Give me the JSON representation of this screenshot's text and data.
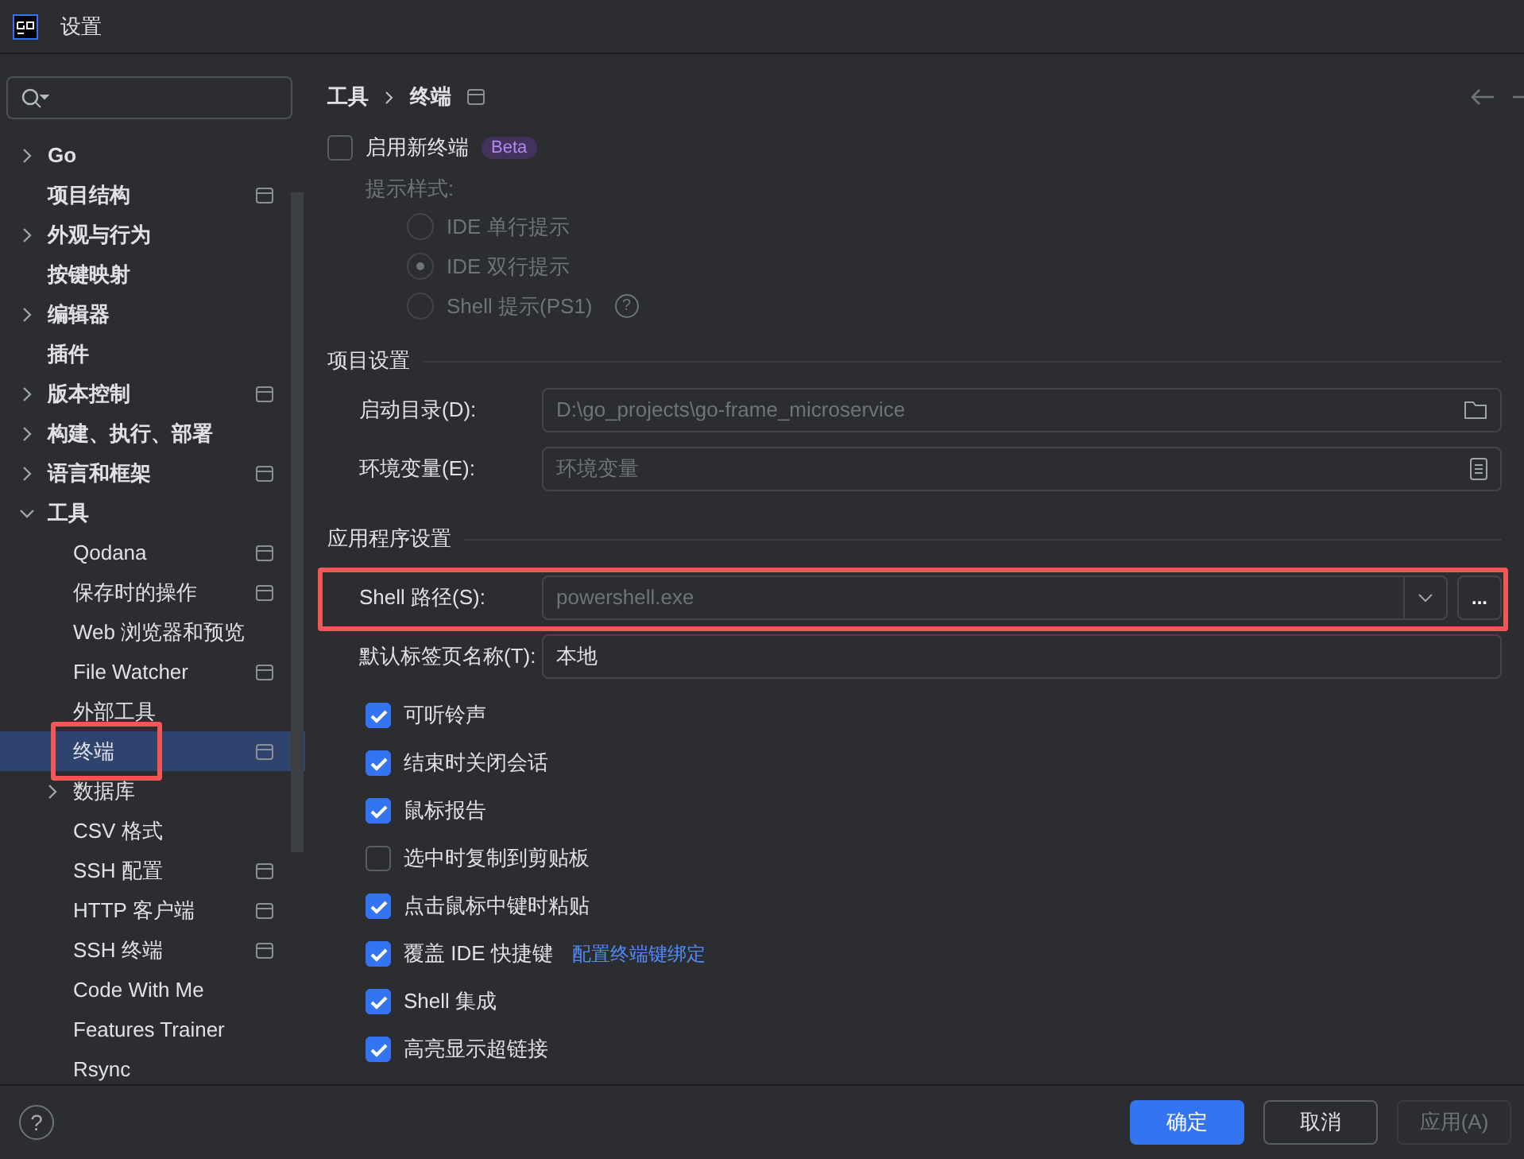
{
  "window": {
    "title": "设置"
  },
  "sidebar": {
    "items": [
      {
        "label": "Go",
        "kind": "group",
        "expanded": false,
        "project_scope": false,
        "selected": false
      },
      {
        "label": "项目结构",
        "kind": "leaf",
        "project_scope": true,
        "selected": false
      },
      {
        "label": "外观与行为",
        "kind": "group",
        "expanded": false,
        "project_scope": false,
        "selected": false
      },
      {
        "label": "按键映射",
        "kind": "leaf",
        "project_scope": false,
        "selected": false
      },
      {
        "label": "编辑器",
        "kind": "group",
        "expanded": false,
        "project_scope": false,
        "selected": false
      },
      {
        "label": "插件",
        "kind": "leaf",
        "project_scope": false,
        "selected": false
      },
      {
        "label": "版本控制",
        "kind": "group",
        "expanded": false,
        "project_scope": true,
        "selected": false
      },
      {
        "label": "构建、执行、部署",
        "kind": "group",
        "expanded": false,
        "project_scope": false,
        "selected": false
      },
      {
        "label": "语言和框架",
        "kind": "group",
        "expanded": false,
        "project_scope": true,
        "selected": false
      },
      {
        "label": "工具",
        "kind": "group",
        "expanded": true,
        "project_scope": false,
        "selected": false,
        "children": [
          {
            "label": "Qodana",
            "kind": "leaf",
            "project_scope": true,
            "selected": false
          },
          {
            "label": "保存时的操作",
            "kind": "leaf",
            "project_scope": true,
            "selected": false
          },
          {
            "label": "Web 浏览器和预览",
            "kind": "leaf",
            "project_scope": false,
            "selected": false
          },
          {
            "label": "File Watcher",
            "kind": "leaf",
            "project_scope": true,
            "selected": false
          },
          {
            "label": "外部工具",
            "kind": "leaf",
            "project_scope": false,
            "selected": false
          },
          {
            "label": "终端",
            "kind": "leaf",
            "project_scope": true,
            "selected": true,
            "highlighted": true
          },
          {
            "label": "数据库",
            "kind": "group",
            "expanded": false,
            "project_scope": false,
            "selected": false
          },
          {
            "label": "CSV 格式",
            "kind": "leaf",
            "project_scope": false,
            "selected": false
          },
          {
            "label": "SSH 配置",
            "kind": "leaf",
            "project_scope": true,
            "selected": false
          },
          {
            "label": "HTTP 客户端",
            "kind": "leaf",
            "project_scope": true,
            "selected": false
          },
          {
            "label": "SSH 终端",
            "kind": "leaf",
            "project_scope": true,
            "selected": false
          },
          {
            "label": "Code With Me",
            "kind": "leaf",
            "project_scope": false,
            "selected": false
          },
          {
            "label": "Features Trainer",
            "kind": "leaf",
            "project_scope": false,
            "selected": false
          },
          {
            "label": "Rsync",
            "kind": "leaf",
            "project_scope": false,
            "selected": false
          }
        ]
      }
    ]
  },
  "breadcrumb": [
    "工具",
    "终端"
  ],
  "new_terminal": {
    "label": "启用新终端",
    "checked": false,
    "badge": "Beta",
    "prompt_label": "提示样式:",
    "disabled": true,
    "options": [
      {
        "label": "IDE 单行提示",
        "selected": false
      },
      {
        "label": "IDE 双行提示",
        "selected": true
      },
      {
        "label": "Shell 提示(PS1)",
        "selected": false,
        "help": "?"
      }
    ]
  },
  "project_settings": {
    "title": "项目设置",
    "fields": [
      {
        "label": "启动目录(D):",
        "placeholder": "D:\\go_projects\\go-frame_microservice",
        "kind": "folder"
      },
      {
        "label": "环境变量(E):",
        "placeholder": "环境变量",
        "kind": "env"
      }
    ]
  },
  "app_settings": {
    "title": "应用程序设置",
    "fields": [
      {
        "label": "Shell 路径(S):",
        "placeholder": "powershell.exe",
        "kind": "combo",
        "highlighted": true,
        "browse": "..."
      },
      {
        "label": "默认标签页名称(T):",
        "value": "本地",
        "kind": "text"
      }
    ],
    "options": [
      {
        "label": "可听铃声",
        "checked": true
      },
      {
        "label": "结束时关闭会话",
        "checked": true
      },
      {
        "label": "鼠标报告",
        "checked": true
      },
      {
        "label": "选中时复制到剪贴板",
        "checked": false
      },
      {
        "label": "点击鼠标中键时粘贴",
        "checked": true
      },
      {
        "label": "覆盖 IDE 快捷键",
        "checked": true,
        "link": "配置终端键绑定"
      },
      {
        "label": "Shell 集成",
        "checked": true
      },
      {
        "label": "高亮显示超链接",
        "checked": true
      }
    ]
  },
  "buttons": [
    {
      "label": "确定",
      "kind": "primary",
      "disabled": false
    },
    {
      "label": "取消",
      "kind": "normal",
      "disabled": false
    },
    {
      "label": "应用(A)",
      "kind": "normal",
      "disabled": true
    }
  ],
  "help": "?"
}
